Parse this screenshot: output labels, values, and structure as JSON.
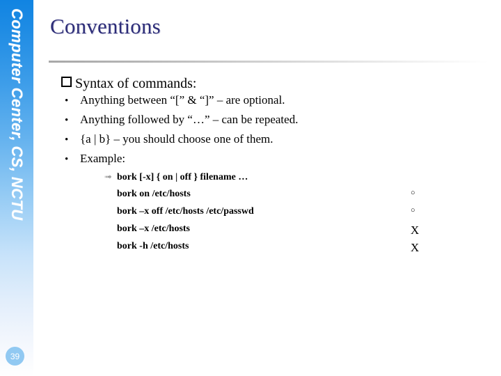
{
  "sidebar": {
    "label": "Computer Center, CS, NCTU",
    "page_number": "39",
    "badge_color": "#91c9f2",
    "gradient_top": "#1184e2",
    "gradient_bottom": "#ffffff"
  },
  "slide": {
    "title": "Conventions",
    "title_color": "#2d2d78",
    "rule_color": "#a8a8a8"
  },
  "content": {
    "heading": {
      "bullet_icon": "hollow-square-bullet",
      "text": "Syntax of commands:"
    },
    "bullets": [
      {
        "bullet_icon": "round-bullet",
        "text": "Anything between “[” & “]” – are optional."
      },
      {
        "bullet_icon": "round-bullet",
        "text": "Anything followed by “…” – can be repeated."
      },
      {
        "bullet_icon": "round-bullet",
        "text": "{a | b} – you should choose one of them."
      },
      {
        "bullet_icon": "round-bullet",
        "text": "Example:"
      }
    ],
    "example": {
      "syntax_bullet_icon": "arrowhead-bullet",
      "syntax": "bork [-x] { on | off } filename …",
      "rows": [
        {
          "command": "bork on /etc/hosts",
          "mark": "○",
          "mark_icon": "circle-ok-marker"
        },
        {
          "command": "bork –x off /etc/hosts /etc/passwd",
          "mark": "○",
          "mark_icon": "circle-ok-marker"
        },
        {
          "command": "bork –x /etc/hosts",
          "mark": "X",
          "mark_icon": "x-fail-marker"
        },
        {
          "command": "bork -h /etc/hosts",
          "mark": "X",
          "mark_icon": "x-fail-marker"
        }
      ]
    }
  }
}
